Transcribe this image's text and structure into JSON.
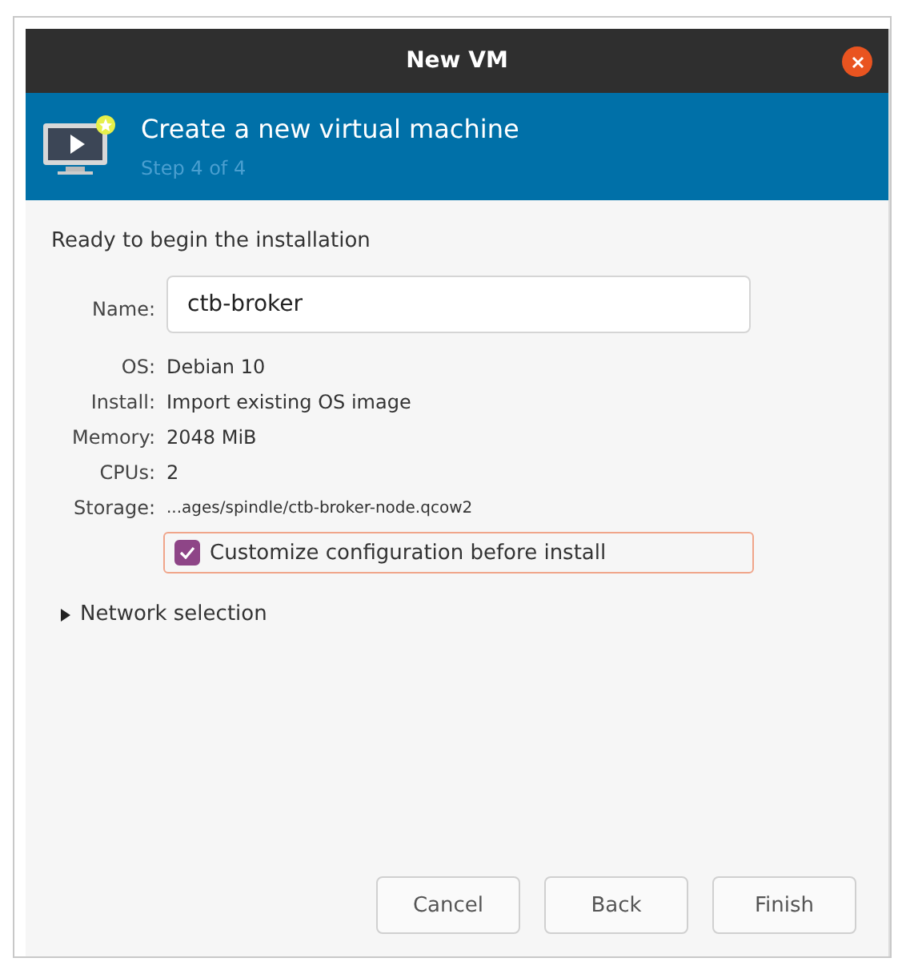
{
  "window": {
    "title": "New VM"
  },
  "banner": {
    "title": "Create a new virtual machine",
    "step": "Step 4 of 4"
  },
  "heading": "Ready to begin the installation",
  "name_field": {
    "label": "Name:",
    "value": "ctb-broker"
  },
  "details": [
    {
      "label": "OS:",
      "value": "Debian 10",
      "small": false
    },
    {
      "label": "Install:",
      "value": "Import existing OS image",
      "small": false
    },
    {
      "label": "Memory:",
      "value": "2048 MiB",
      "small": false
    },
    {
      "label": "CPUs:",
      "value": "2",
      "small": false
    },
    {
      "label": "Storage:",
      "value": "...ages/spindle/ctb-broker-node.qcow2",
      "small": true
    }
  ],
  "customize": {
    "label": "Customize configuration before install",
    "checked": true,
    "focused": true
  },
  "network": {
    "label": "Network selection",
    "expanded": false
  },
  "buttons": [
    "Cancel",
    "Back",
    "Finish"
  ]
}
